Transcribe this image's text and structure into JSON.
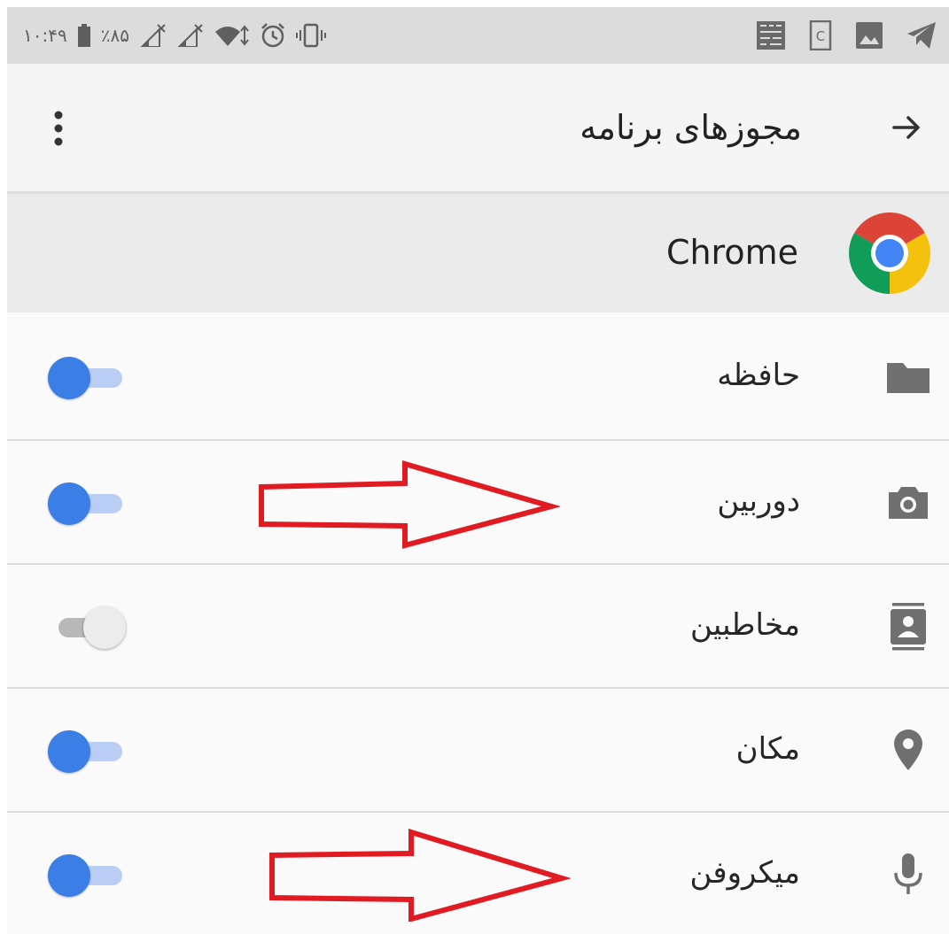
{
  "status_bar": {
    "time": "۱۰:۴۹",
    "battery_percent": "٪۸۵",
    "left_icons": [
      "battery-icon",
      "signal-icon",
      "signal-icon",
      "wifi-icon",
      "alarm-icon",
      "vibrate-icon"
    ],
    "right_icons": [
      "notification-icon",
      "notification-icon",
      "image-icon",
      "telegram-icon"
    ]
  },
  "app_bar": {
    "title": "مجوزهای برنامه",
    "back_icon": "arrow-icon",
    "menu_icon": "more-vert-icon"
  },
  "app": {
    "name": "Chrome",
    "icon": "chrome-logo"
  },
  "permissions": [
    {
      "label": "حافظه",
      "icon": "folder-icon",
      "enabled": true
    },
    {
      "label": "دوربین",
      "icon": "camera-icon",
      "enabled": true
    },
    {
      "label": "مخاطبین",
      "icon": "contacts-icon",
      "enabled": false
    },
    {
      "label": "مکان",
      "icon": "location-icon",
      "enabled": true
    },
    {
      "label": "میکروفن",
      "icon": "microphone-icon",
      "enabled": true
    }
  ],
  "colors": {
    "toggle_on_thumb": "#3b7ee6",
    "toggle_on_track": "#b9cdf5",
    "toggle_off_thumb": "#ececec",
    "toggle_off_track": "#b8b8b8",
    "annotation_arrow": "#e01b22"
  }
}
